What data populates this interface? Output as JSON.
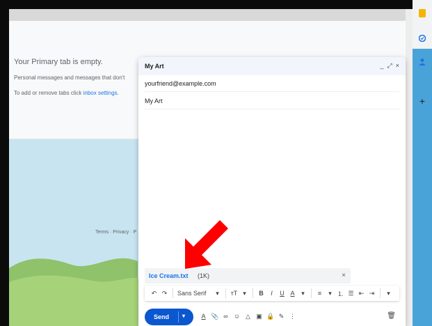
{
  "inbox": {
    "empty_title": "Your Primary tab is empty.",
    "line1": "Personal messages and messages that don't",
    "line2_prefix": "To add or remove tabs click ",
    "line2_link": "inbox settings",
    "line2_suffix": ".",
    "footer": "Terms · Privacy · P"
  },
  "compose": {
    "title": "My Art",
    "minimize_icon": "_",
    "expand_icon": "⤢",
    "close_icon": "×",
    "to": "yourfriend@example.com",
    "subject": "My Art",
    "attachment": {
      "name": "Ice Cream.txt",
      "size": "(1K)",
      "remove": "×"
    },
    "format_bar": {
      "undo": "↶",
      "redo": "↷",
      "font": "Sans Serif",
      "font_caret": "▾",
      "size": "ᴛT",
      "size_caret": "▾",
      "bold": "B",
      "italic": "I",
      "underline": "U",
      "text_color": "A",
      "color_caret": "▾",
      "align": "≡",
      "align_caret": "▾",
      "numbered": "⒈",
      "bulleted": "☰",
      "indent_less": "⇤",
      "indent_more": "⇥",
      "more": "▾"
    },
    "send_label": "Send",
    "send_caret": "▾",
    "bottom_icons": {
      "formatting": "A",
      "attach": "📎",
      "link": "∞",
      "emoji": "☺",
      "drive": "△",
      "photo": "▣",
      "lock": "🔒",
      "signature": "✎",
      "more": "⋮"
    },
    "trash": "🗑"
  },
  "side": {
    "add": "+"
  },
  "colors": {
    "send": "#0b57d0",
    "link": "#1a73e8",
    "arrow": "#ff0000",
    "sky": "#c8e4f1",
    "grass": "#a6d37a"
  }
}
